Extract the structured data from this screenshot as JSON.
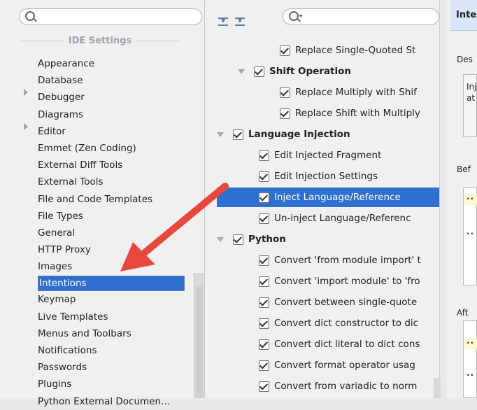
{
  "left_panel": {
    "section_title": "IDE Settings",
    "items": [
      {
        "label": "Appearance",
        "expandable": false
      },
      {
        "label": "Database",
        "expandable": false
      },
      {
        "label": "Debugger",
        "expandable": true
      },
      {
        "label": "Diagrams",
        "expandable": false
      },
      {
        "label": "Editor",
        "expandable": true
      },
      {
        "label": "Emmet (Zen Coding)",
        "expandable": false
      },
      {
        "label": "External Diff Tools",
        "expandable": false
      },
      {
        "label": "External Tools",
        "expandable": false
      },
      {
        "label": "File and Code Templates",
        "expandable": false
      },
      {
        "label": "File Types",
        "expandable": false
      },
      {
        "label": "General",
        "expandable": false
      },
      {
        "label": "HTTP Proxy",
        "expandable": false
      },
      {
        "label": "Images",
        "expandable": false
      },
      {
        "label": "Intentions",
        "expandable": false,
        "selected": true
      },
      {
        "label": "Keymap",
        "expandable": false
      },
      {
        "label": "Live Templates",
        "expandable": false
      },
      {
        "label": "Menus and Toolbars",
        "expandable": false
      },
      {
        "label": "Notifications",
        "expandable": false
      },
      {
        "label": "Passwords",
        "expandable": false
      },
      {
        "label": "Plugins",
        "expandable": false
      },
      {
        "label": "Python External Documen…",
        "expandable": false
      }
    ]
  },
  "middle_panel": {
    "rows": [
      {
        "label": "Replace Single-Quoted St",
        "level": 2,
        "checked": true,
        "group": false,
        "expanded": false
      },
      {
        "label": "Shift Operation",
        "level": 1,
        "checked": true,
        "group": true,
        "expanded": true
      },
      {
        "label": "Replace Multiply with Shif",
        "level": 2,
        "checked": true,
        "group": false
      },
      {
        "label": "Replace Shift with Multiply",
        "level": 2,
        "checked": true,
        "group": false
      },
      {
        "label": "Language Injection",
        "level": 0,
        "checked": true,
        "group": true,
        "expanded": true
      },
      {
        "label": "Edit Injected Fragment",
        "level": 1,
        "checked": true,
        "group": false
      },
      {
        "label": "Edit Injection Settings",
        "level": 1,
        "checked": true,
        "group": false
      },
      {
        "label": "Inject Language/Reference",
        "level": 1,
        "checked": true,
        "group": false,
        "selected": true
      },
      {
        "label": "Un-inject Language/Referenc",
        "level": 1,
        "checked": true,
        "group": false
      },
      {
        "label": "Python",
        "level": 0,
        "checked": true,
        "group": true,
        "expanded": true
      },
      {
        "label": "Convert 'from module import' t",
        "level": 1,
        "checked": true,
        "group": false
      },
      {
        "label": "Convert 'import module' to 'fro",
        "level": 1,
        "checked": true,
        "group": false
      },
      {
        "label": "Convert between single-quote",
        "level": 1,
        "checked": true,
        "group": false
      },
      {
        "label": "Convert dict constructor to dic",
        "level": 1,
        "checked": true,
        "group": false
      },
      {
        "label": "Convert dict literal to dict cons",
        "level": 1,
        "checked": true,
        "group": false
      },
      {
        "label": "Convert format operator usag",
        "level": 1,
        "checked": true,
        "group": false
      },
      {
        "label": "Convert from variadic to norm",
        "level": 1,
        "checked": true,
        "group": false
      }
    ]
  },
  "right_panel": {
    "tab_label": "Inte",
    "description_label": "Des",
    "description_text": "Inj at",
    "before_label": "Bef",
    "after_label": "Aft"
  },
  "colors": {
    "selection": "#2f6fcf",
    "arrow": "#e8473d"
  }
}
